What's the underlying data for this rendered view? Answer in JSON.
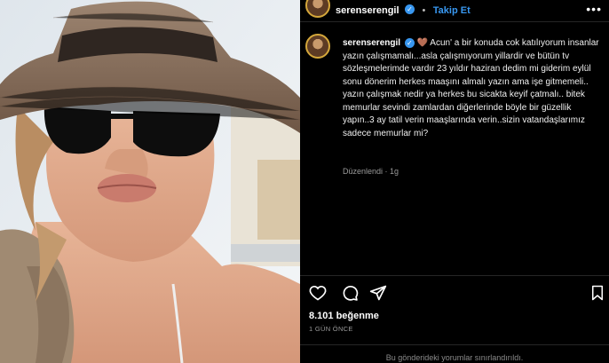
{
  "post": {
    "username": "serenserengil",
    "follow_label": "Takip Et",
    "separator": "•",
    "caption_username": "serenserengil",
    "caption": "🤎 Acun' a bir konuda cok katılıyorum insanlar yazın çalışmamalı...asla çalışmıyorum yillardir ve bütün tv sözleşmelerimde vardır 23 yıldır haziran dedim mi giderim eylül sonu dönerim herkes maaşını almalı yazın ama işe gitmemeli.. yazın çalışmak nedir ya herkes bu sicakta keyif çatmalı.. bitek memurlar sevindi zamlardan diğerlerinde böyle bir güzellik yapın..3 ay tatil verin maaşlarında verin..sizin vatandaşlarımız sadece memurlar mi?",
    "edited_label": "Düzenlendi · 1g",
    "likes": "8.101 beğenme",
    "time_ago": "1 GÜN ÖNCE",
    "comments_restricted": "Bu gönderideki yorumlar sınırlandırıldı."
  },
  "colors": {
    "accent": "#3897f0",
    "panel_bg": "#000000",
    "ring": "#d4a73b"
  },
  "icons": [
    "heart-icon",
    "comment-icon",
    "share-icon",
    "bookmark-icon",
    "more-icon",
    "verified-badge-icon"
  ]
}
